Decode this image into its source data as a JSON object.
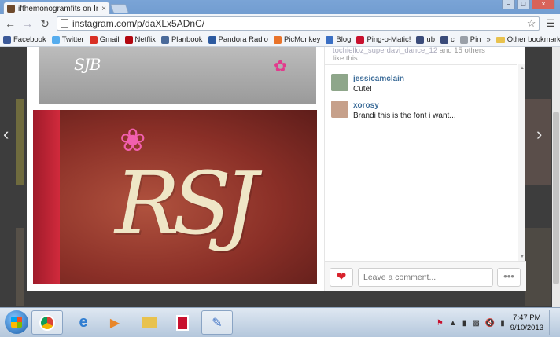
{
  "browser": {
    "tab_title": "ifthemonogramfits on Inst",
    "tab_close": "×",
    "window_buttons": [
      "–",
      "□",
      "×"
    ],
    "back_icon": "arrow-left-icon",
    "forward_icon": "arrow-right-icon",
    "reload_icon": "reload-icon",
    "url": "instagram.com/p/daXLx5ADnC/",
    "star_icon": "star-icon",
    "menu_icon": "menu-icon",
    "bookmarks": [
      {
        "label": "Facebook",
        "color": "#3b5998"
      },
      {
        "label": "Twitter",
        "color": "#55acee"
      },
      {
        "label": "Gmail",
        "color": "#d93025"
      },
      {
        "label": "Netflix",
        "color": "#b20710"
      },
      {
        "label": "Planbook",
        "color": "#4a6a9a"
      },
      {
        "label": "Pandora Radio",
        "color": "#2c5aa0"
      },
      {
        "label": "PicMonkey",
        "color": "#e8732a"
      },
      {
        "label": "Blog",
        "color": "#3a6fc4"
      },
      {
        "label": "Ping-o-Matic!",
        "color": "#c8102e"
      },
      {
        "label": "ub",
        "color": "#3a4b7a"
      },
      {
        "label": "c",
        "color": "#3a4b7a"
      },
      {
        "label": "Pin",
        "color": "#9aa0a8"
      }
    ],
    "bookmarks_more": "»",
    "other_bookmarks": "Other bookmarks"
  },
  "post": {
    "likes_line_top": "tochielloz_superdavi_dance_12",
    "likes_line": "and 15 others",
    "likes_line2": "like this.",
    "comments": [
      {
        "user": "jessicamclain",
        "text": "Cute!"
      },
      {
        "user": "xorosy",
        "text": "Brandi this is the font i want..."
      }
    ],
    "comment_placeholder": "Leave a comment...",
    "like_icon": "heart-icon",
    "more_label": "•••",
    "photo_small_mono": "SJB",
    "photo_main_mono": "RSJ"
  },
  "nav": {
    "prev_icon": "chevron-left-icon",
    "next_icon": "chevron-right-icon"
  },
  "taskbar": {
    "apps": [
      "chrome",
      "internet-explorer",
      "media-player",
      "file-explorer",
      "adobe",
      "paint"
    ],
    "time": "7:47 PM",
    "date": "9/10/2013"
  }
}
